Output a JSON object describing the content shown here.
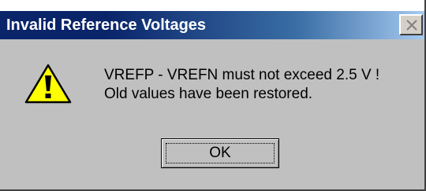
{
  "window": {
    "title": "Invalid Reference Voltages"
  },
  "titlebar": {
    "close_icon": "close-icon"
  },
  "message": {
    "icon": "warning-icon",
    "line1": "VREFP - VREFN must not exceed 2.5 V !",
    "line2": "Old values have been restored."
  },
  "buttons": {
    "ok_label": "OK"
  },
  "colors": {
    "titlebar_start": "#0a246a",
    "titlebar_end": "#a6caf0",
    "dialog_background": "#c0c0c0",
    "warning_fill": "#ffff00"
  }
}
